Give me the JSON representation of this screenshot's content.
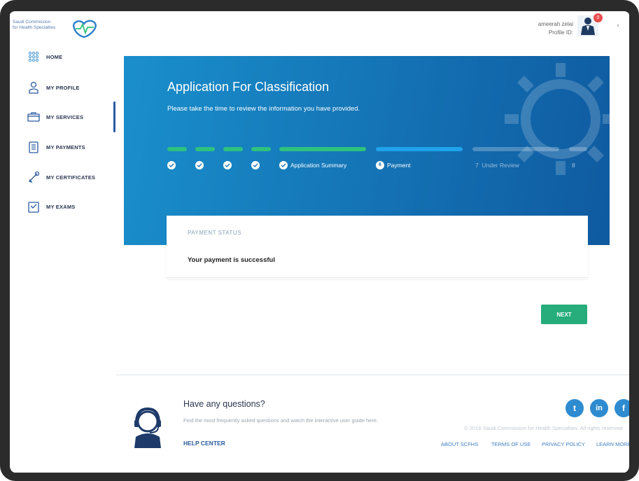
{
  "logo": {
    "line1": "Saudi Commission",
    "line2": "for Health Specialties",
    "icon": "scfhs-logo-icon"
  },
  "user": {
    "name": "ameerah zelai",
    "profile_id_label": "Profile ID:",
    "notification_count": "0"
  },
  "sidebar": {
    "items": [
      {
        "label": "HOME",
        "icon": "grid-icon"
      },
      {
        "label": "MY PROFILE",
        "icon": "profile-icon"
      },
      {
        "label": "MY SERVICES",
        "icon": "services-icon"
      },
      {
        "label": "MY PAYMENTS",
        "icon": "payments-icon"
      },
      {
        "label": "MY CERTIFICATES",
        "icon": "certificates-icon"
      },
      {
        "label": "MY EXAMS",
        "icon": "exams-icon"
      }
    ],
    "active": "MY SERVICES"
  },
  "hero": {
    "title": "Application For Classification",
    "subtitle": "Please take the time to review the information you have provided.",
    "steps": [
      {
        "label": "",
        "state": "done"
      },
      {
        "label": "",
        "state": "done"
      },
      {
        "label": "",
        "state": "done"
      },
      {
        "label": "",
        "state": "done"
      },
      {
        "label": "Application Summary",
        "state": "done"
      },
      {
        "label": "Payment",
        "number": "6",
        "state": "current"
      },
      {
        "label": "Under Review",
        "number": "7",
        "state": "pending"
      },
      {
        "label": "",
        "number": "8",
        "state": "pending"
      }
    ]
  },
  "payment": {
    "status_title": "PAYMENT STATUS",
    "message": "Your payment is successful"
  },
  "actions": {
    "next_label": "NEXT"
  },
  "footer": {
    "question_title": "Have any questions?",
    "question_text": "Find the most frequently asked questions and watch the interactive user guide here.",
    "help_center": "HELP CENTER",
    "copyright": "© 2018 Saudi Commission for Health Specialties. All rights reserved.",
    "links": [
      "ABOUT SCFHS",
      "TERMS OF USE",
      "PRIVACY POLICY",
      "LEARN MORE"
    ],
    "social": [
      {
        "name": "twitter-icon",
        "glyph": "t"
      },
      {
        "name": "linkedin-icon",
        "glyph": "in"
      },
      {
        "name": "facebook-icon",
        "glyph": "f"
      }
    ]
  },
  "colors": {
    "accent": "#1577b8",
    "success": "#27ad7c",
    "done_step": "#2ec27e",
    "current_step": "#1fa3ec"
  }
}
